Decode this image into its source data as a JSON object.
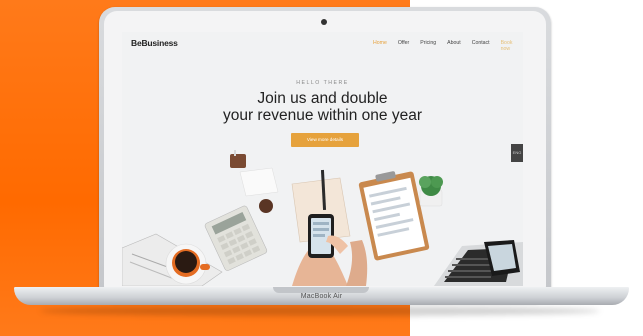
{
  "colors": {
    "orange": "#ff6a00",
    "accent": "#e6a23c"
  },
  "site": {
    "logo": "BeBusiness",
    "menu": [
      "Home",
      "Offer",
      "Pricing",
      "About",
      "Contact",
      "Book now"
    ],
    "eyebrow": "HELLO THERE",
    "headline_line1": "Join us and double",
    "headline_line2": "your revenue within one year",
    "cta_label": "View more details",
    "side_tab": "ENG"
  },
  "device": {
    "label": "MacBook Air"
  }
}
